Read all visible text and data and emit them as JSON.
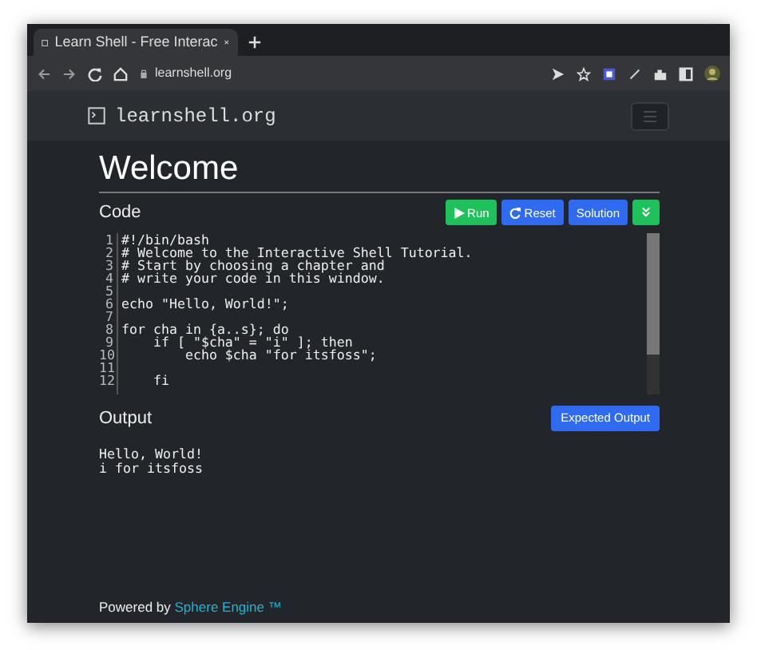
{
  "browser": {
    "tab_title": "Learn Shell - Free Interac",
    "url": "learnshell.org"
  },
  "navbar": {
    "brand": "learnshell.org"
  },
  "heading": "Welcome",
  "code": {
    "label": "Code",
    "buttons": [
      {
        "kind": "run",
        "label": "Run"
      },
      {
        "kind": "reset",
        "label": "Reset"
      },
      {
        "kind": "solution",
        "label": "Solution"
      },
      {
        "kind": "expand"
      }
    ],
    "lines": [
      {
        "number": "1",
        "text": "#!/bin/bash"
      },
      {
        "number": "2",
        "text": "# Welcome to the Interactive Shell Tutorial."
      },
      {
        "number": "3",
        "text": "# Start by choosing a chapter and"
      },
      {
        "number": "4",
        "text": "# write your code in this window."
      },
      {
        "number": "5"
      },
      {
        "number": "6",
        "text": "echo \"Hello, World!\";"
      },
      {
        "number": "7"
      },
      {
        "number": "8",
        "text": "for cha in {a..s}; do"
      },
      {
        "number": "9",
        "text": "    if [ \"$cha\" = \"i\" ]; then"
      },
      {
        "number": "10",
        "text": "        echo $cha \"for itsfoss\";"
      },
      {
        "number": "11"
      },
      {
        "number": "12",
        "text": "    fi"
      }
    ]
  },
  "output": {
    "label": "Output",
    "button": "Expected Output",
    "lines": [
      "Hello, World!",
      "i for itsfoss"
    ]
  },
  "footer": {
    "text": "Powered by",
    "link": "Sphere Engine ™"
  }
}
